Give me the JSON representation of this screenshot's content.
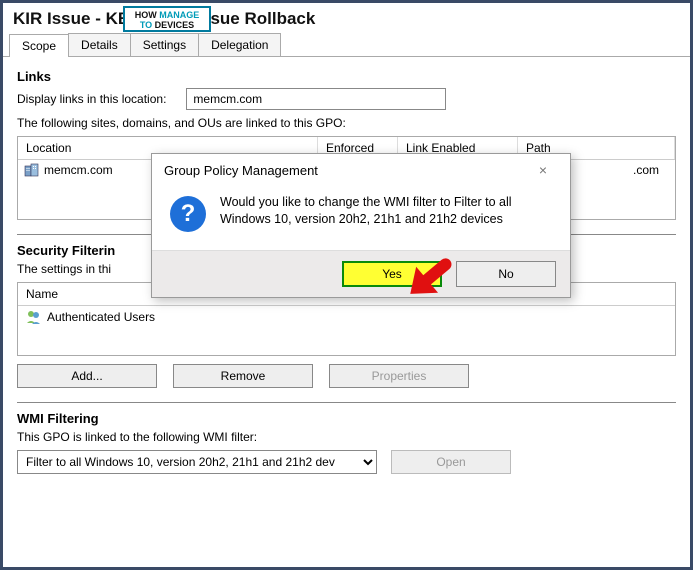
{
  "header": {
    "title_prefix": "KIR Issue - KB",
    "title_suffix": "Issue Rollback"
  },
  "watermark": {
    "line1_black": "HOW",
    "line1_teal": "MANAGE",
    "line2_teal": "TO",
    "line2_black": "DEVICES"
  },
  "tabs": [
    {
      "label": "Scope",
      "active": true
    },
    {
      "label": "Details",
      "active": false
    },
    {
      "label": "Settings",
      "active": false
    },
    {
      "label": "Delegation",
      "active": false
    }
  ],
  "links": {
    "heading": "Links",
    "display_label": "Display links in this location:",
    "location_value": "memcm.com",
    "intro": "The following sites, domains, and OUs are linked to this GPO:",
    "columns": [
      "Location",
      "Enforced",
      "Link Enabled",
      "Path"
    ],
    "rows": [
      {
        "name": "memcm.com",
        "path_suffix": ".com"
      }
    ]
  },
  "security_filtering": {
    "heading": "Security Filterin",
    "intro": "The settings in thi",
    "column_name": "Name",
    "rows": [
      "Authenticated Users"
    ],
    "buttons": {
      "add": "Add...",
      "remove": "Remove",
      "properties": "Properties"
    }
  },
  "wmi_filtering": {
    "heading": "WMI Filtering",
    "intro": "This GPO is linked to the following WMI filter:",
    "selected": "Filter to all Windows 10, version 20h2, 21h1 and 21h2 dev",
    "open_btn": "Open"
  },
  "dialog": {
    "title": "Group Policy Management",
    "message": "Would you like to change the WMI filter to Filter to all Windows 10, version 20h2, 21h1 and 21h2 devices",
    "yes": "Yes",
    "no": "No"
  }
}
